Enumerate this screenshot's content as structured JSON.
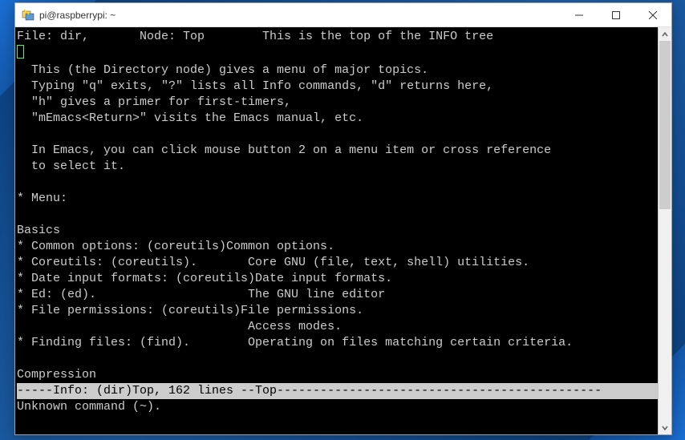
{
  "window": {
    "title": "pi@raspberrypi: ~"
  },
  "info": {
    "header": "File: dir,       Node: Top        This is the top of the INFO tree",
    "intro": [
      "  This (the Directory node) gives a menu of major topics.",
      "  Typing \"q\" exits, \"?\" lists all Info commands, \"d\" returns here,",
      "  \"h\" gives a primer for first-timers,",
      "  \"mEmacs<Return>\" visits the Emacs manual, etc.",
      "",
      "  In Emacs, you can click mouse button 2 on a menu item or cross reference",
      "  to select it."
    ],
    "menu_label": "* Menu:",
    "sections": [
      {
        "heading": "Basics",
        "items": [
          "* Common options: (coreutils)Common options.",
          "* Coreutils: (coreutils).       Core GNU (file, text, shell) utilities.",
          "* Date input formats: (coreutils)Date input formats.",
          "* Ed: (ed).                     The GNU line editor",
          "* File permissions: (coreutils)File permissions.",
          "                                Access modes.",
          "* Finding files: (find).        Operating on files matching certain criteria."
        ]
      },
      {
        "heading": "Compression",
        "items": []
      }
    ],
    "statusline": "-----Info: (dir)Top, 162 lines --Top---------------------------------------------",
    "commandline": "Unknown command (~)."
  }
}
